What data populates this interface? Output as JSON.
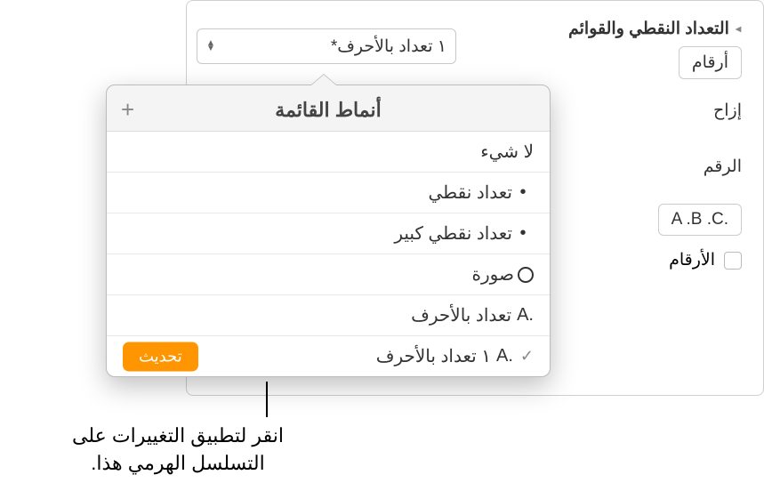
{
  "section": {
    "title": "التعداد النقطي والقوائم",
    "numbers_tab": "أرقام",
    "indent_label": "إزاح",
    "number_label": "الرقم",
    "abc_value": ".A .B .C",
    "tiered_checkbox_label": "الأرقام"
  },
  "dropdown": {
    "value": "١ تعداد بالأحرف*"
  },
  "popover": {
    "title": "أنماط القائمة",
    "items": [
      {
        "label": "لا شيء",
        "glyph": "none"
      },
      {
        "label": "تعداد نقطي",
        "glyph": "dot"
      },
      {
        "label": "تعداد نقطي كبير",
        "glyph": "dot"
      },
      {
        "label": "صورة",
        "glyph": "circle"
      },
      {
        "label": "تعداد بالأحرف",
        "prefix": "A."
      },
      {
        "label": "١ تعداد بالأحرف",
        "prefix": "A.",
        "checked": true,
        "update": true
      }
    ],
    "update_button": "تحديث"
  },
  "callout": {
    "text": "انقر لتطبيق التغييرات على التسلسل الهرمي هذا."
  }
}
